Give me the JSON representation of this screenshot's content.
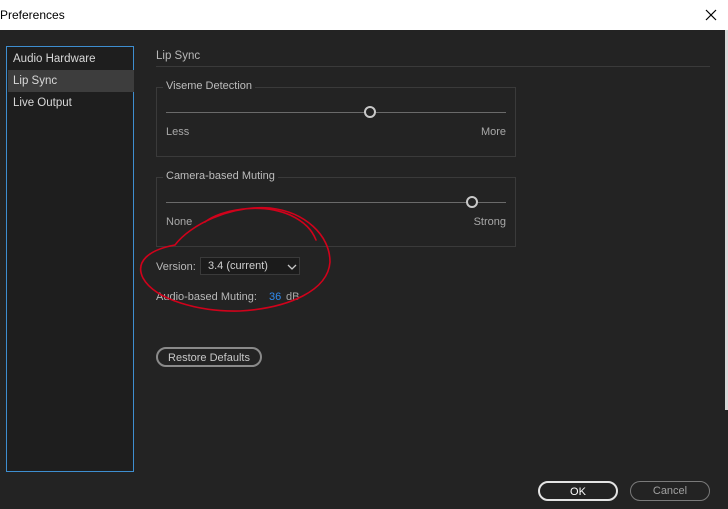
{
  "window": {
    "title": "Preferences"
  },
  "sidebar": {
    "items": [
      {
        "label": "Audio Hardware",
        "selected": false
      },
      {
        "label": "Lip Sync",
        "selected": true
      },
      {
        "label": "Live Output",
        "selected": false
      }
    ]
  },
  "section": {
    "title": "Lip Sync"
  },
  "viseme_detection": {
    "title": "Viseme Detection",
    "min_label": "Less",
    "max_label": "More",
    "level": 0.6
  },
  "camera_muting": {
    "title": "Camera-based Muting",
    "min_label": "None",
    "max_label": "Strong",
    "level": 0.9
  },
  "version": {
    "label": "Version:",
    "selected": "3.4 (current)"
  },
  "audio_muting": {
    "label": "Audio-based Muting:",
    "value": "36",
    "unit": "dB"
  },
  "buttons": {
    "restore": "Restore Defaults",
    "ok": "OK",
    "cancel": "Cancel"
  },
  "colors": {
    "accent": "#3e8ed0",
    "value": "#2f8bf0",
    "annotation": "#d0021b"
  }
}
